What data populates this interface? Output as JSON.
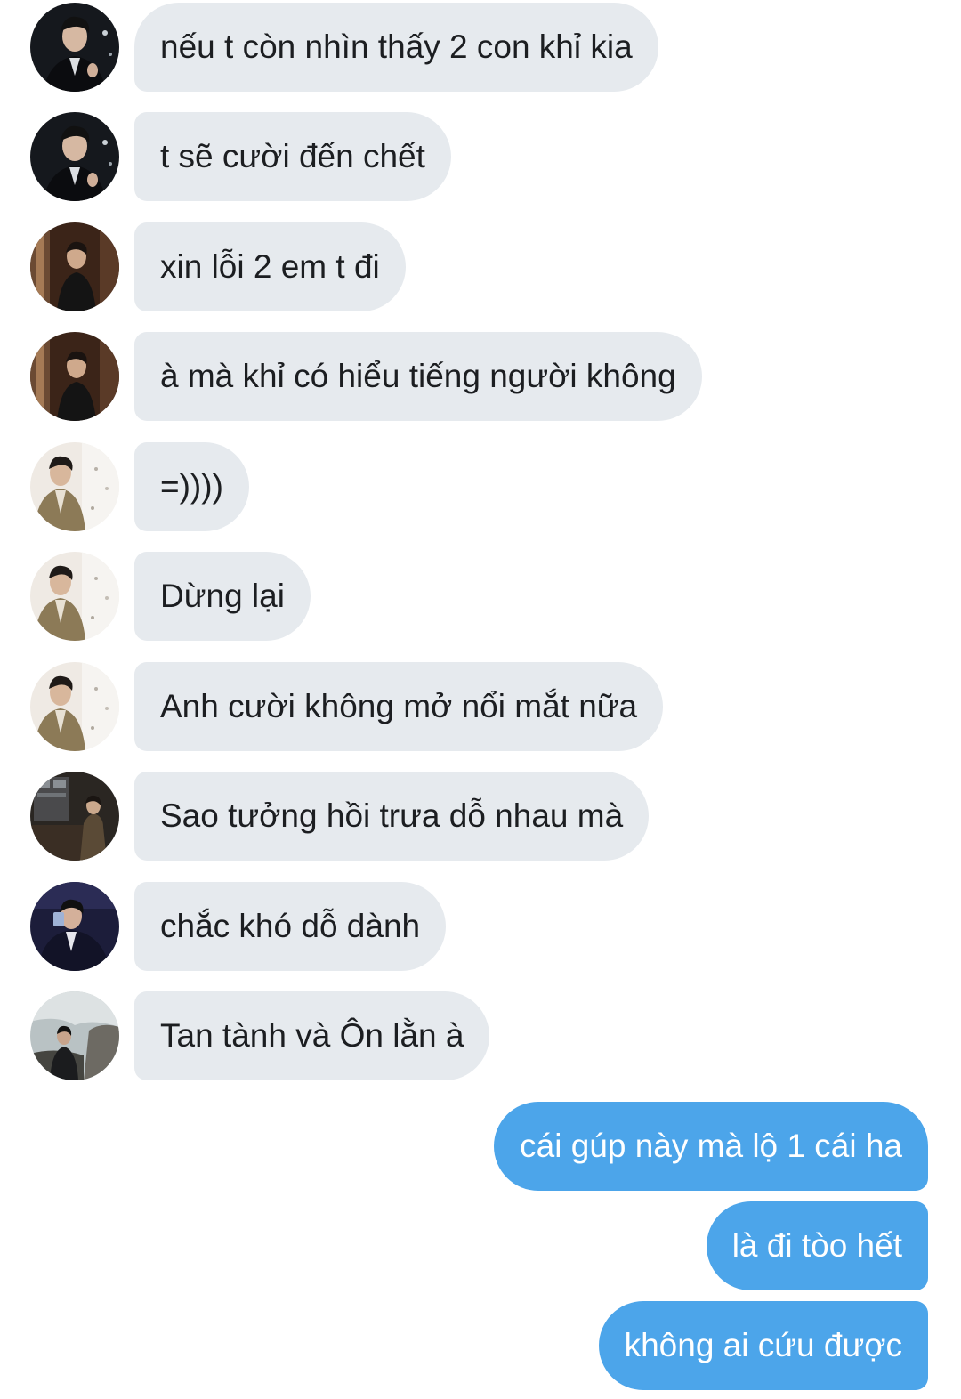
{
  "colors": {
    "incoming_bubble": "#e6eaee",
    "incoming_text": "#1c1e21",
    "outgoing_bubble": "#4ca5ea",
    "outgoing_text": "#ffffff",
    "background": "#ffffff"
  },
  "messages": [
    {
      "direction": "incoming",
      "avatar": "avatar-dark-suit-icon",
      "text": "nếu t còn nhìn thấy 2 con khỉ kia"
    },
    {
      "direction": "incoming",
      "avatar": "avatar-dark-suit-icon",
      "text": "t sẽ cười đến chết"
    },
    {
      "direction": "incoming",
      "avatar": "avatar-brown-room-icon",
      "text": "xin lỗi 2 em t đi"
    },
    {
      "direction": "incoming",
      "avatar": "avatar-brown-room-icon",
      "text": "à mà khỉ có hiểu tiếng người không"
    },
    {
      "direction": "incoming",
      "avatar": "avatar-tweed-jacket-icon",
      "text": "=))))"
    },
    {
      "direction": "incoming",
      "avatar": "avatar-tweed-jacket-icon",
      "text": "Dừng lại"
    },
    {
      "direction": "incoming",
      "avatar": "avatar-tweed-jacket-icon",
      "text": "Anh cười không mở nổi mắt nữa"
    },
    {
      "direction": "incoming",
      "avatar": "avatar-shop-interior-icon",
      "text": "Sao tưởng hồi trưa dỗ nhau mà"
    },
    {
      "direction": "incoming",
      "avatar": "avatar-navy-drink-icon",
      "text": "chắc khó dỗ dành"
    },
    {
      "direction": "incoming",
      "avatar": "avatar-rocky-outdoor-icon",
      "text": "Tan tành và Ôn lằn à"
    },
    {
      "direction": "outgoing",
      "text": "cái gúp này mà lộ 1 cái ha"
    },
    {
      "direction": "outgoing",
      "text": "là đi tòo hết"
    },
    {
      "direction": "outgoing",
      "text": "không ai cứu được"
    }
  ]
}
